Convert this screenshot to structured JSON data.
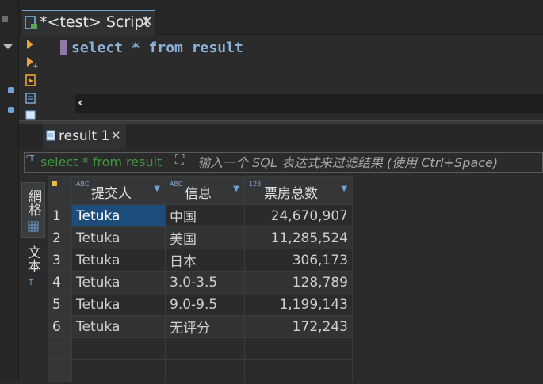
{
  "editor": {
    "tab_title": "*<test> Script",
    "tab_close": "✕",
    "sql": "select * from result",
    "scroll_left": "‹"
  },
  "results": {
    "tab_title": "result 1",
    "tab_close": "✕",
    "filter_sql": "select * from result",
    "filter_placeholder": "输入一个 SQL 表达式来过滤结果 (使用 Ctrl+Space)",
    "side_tabs": [
      "網格",
      "文本"
    ],
    "columns": [
      {
        "type": "ABC",
        "label": "提交人"
      },
      {
        "type": "ABC",
        "label": "信息"
      },
      {
        "type": "123",
        "label": "票房总数"
      }
    ],
    "rows": [
      {
        "n": "1",
        "user": "Tetuka",
        "info": "中国",
        "total": "24,670,907"
      },
      {
        "n": "2",
        "user": "Tetuka",
        "info": "美国",
        "total": "11,285,524"
      },
      {
        "n": "3",
        "user": "Tetuka",
        "info": "日本",
        "total": "306,173"
      },
      {
        "n": "4",
        "user": "Tetuka",
        "info": "3.0-3.5",
        "total": "128,789"
      },
      {
        "n": "5",
        "user": "Tetuka",
        "info": "9.0-9.5",
        "total": "1,199,143"
      },
      {
        "n": "6",
        "user": "Tetuka",
        "info": "无评分",
        "total": "172,243"
      }
    ]
  },
  "colors": {
    "accent": "#6fa3d6",
    "selection": "#1d4d7a",
    "sql_keyword": "#8bb3d9",
    "filter_green": "#3e9a3e"
  }
}
